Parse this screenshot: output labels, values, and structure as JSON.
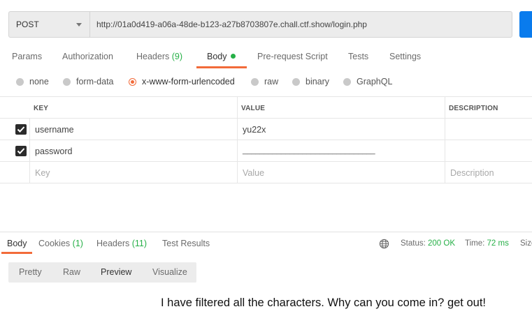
{
  "request": {
    "method": "POST",
    "url": "http://01a0d419-a06a-48de-b123-a27b8703807e.chall.ctf.show/login.php"
  },
  "request_tabs": [
    {
      "label": "Params"
    },
    {
      "label": "Authorization"
    },
    {
      "label": "Headers",
      "count": "(9)"
    },
    {
      "label": "Body"
    },
    {
      "label": "Pre-request Script"
    },
    {
      "label": "Tests"
    },
    {
      "label": "Settings"
    }
  ],
  "body_types": [
    {
      "label": "none",
      "selected": false
    },
    {
      "label": "form-data",
      "selected": false
    },
    {
      "label": "x-www-form-urlencoded",
      "selected": true
    },
    {
      "label": "raw",
      "selected": false
    },
    {
      "label": "binary",
      "selected": false
    },
    {
      "label": "GraphQL",
      "selected": false
    }
  ],
  "table": {
    "headers": {
      "key": "KEY",
      "value": "VALUE",
      "description": "DESCRIPTION"
    },
    "rows": [
      {
        "key": "username",
        "value": "yu22x",
        "checked": true
      },
      {
        "key": "password",
        "value": "_______________________________",
        "checked": true
      }
    ],
    "placeholders": {
      "key": "Key",
      "value": "Value",
      "description": "Description"
    }
  },
  "response_tabs": [
    {
      "label": "Body"
    },
    {
      "label": "Cookies",
      "count": "(1)"
    },
    {
      "label": "Headers",
      "count": "(11)"
    },
    {
      "label": "Test Results"
    }
  ],
  "status": {
    "status_label": "Status:",
    "status_value": "200 OK",
    "time_label": "Time:",
    "time_value": "72 ms",
    "size_label": "Size"
  },
  "view_modes": [
    "Pretty",
    "Raw",
    "Preview",
    "Visualize"
  ],
  "response_text": "I have filtered all the characters. Why can you come in? get out!",
  "colors": {
    "accent": "#f26b3a",
    "success": "#26b047",
    "send": "#097bed"
  }
}
